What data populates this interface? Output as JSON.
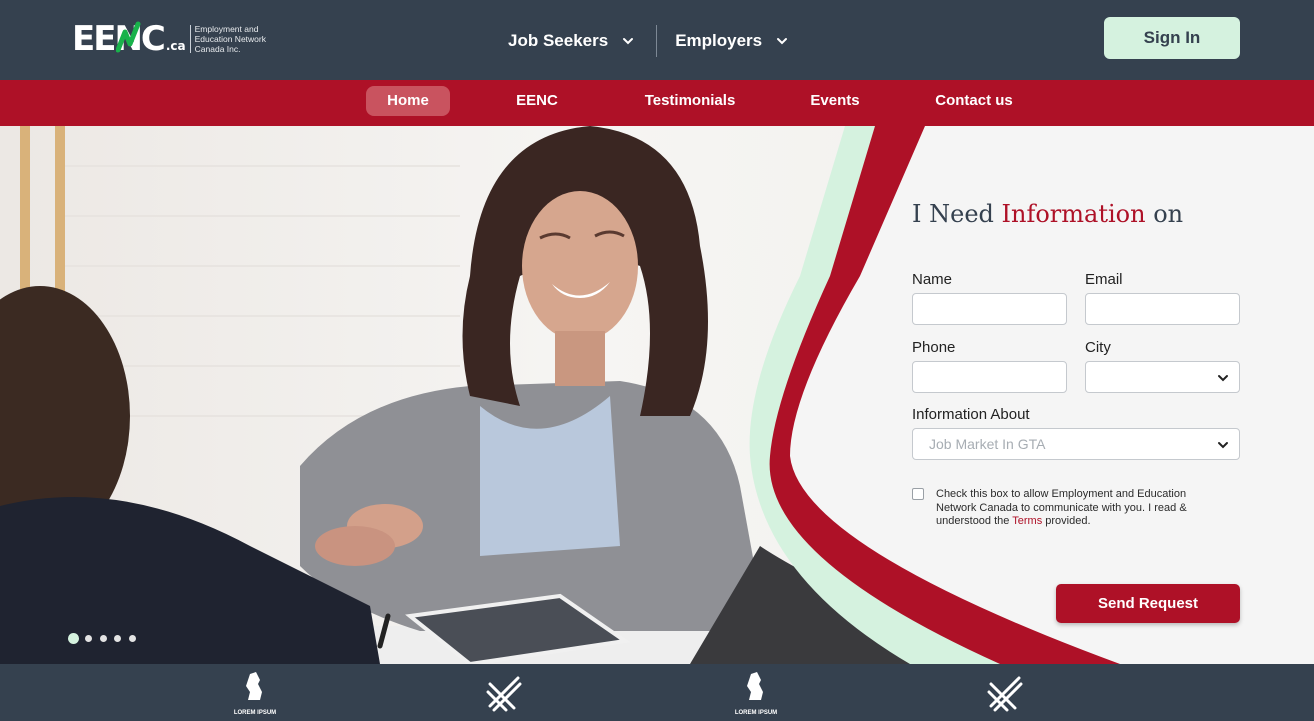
{
  "header": {
    "logo_text": "EENC",
    "logo_suffix": ".ca",
    "logo_tagline": "Employment and Education Network Canada Inc.",
    "nav": [
      {
        "label": "Job Seekers"
      },
      {
        "label": "Employers"
      }
    ],
    "signin_label": "Sign In"
  },
  "subnav": {
    "items": [
      {
        "label": "Home",
        "active": true
      },
      {
        "label": "EENC",
        "active": false
      },
      {
        "label": "Testimonials",
        "active": false
      },
      {
        "label": "Events",
        "active": false
      },
      {
        "label": "Contact us",
        "active": false
      }
    ]
  },
  "form": {
    "title_pre": "I Need ",
    "title_highlight": "Information",
    "title_post": " on",
    "name_label": "Name",
    "email_label": "Email",
    "phone_label": "Phone",
    "city_label": "City",
    "city_value": "",
    "info_label": "Information About",
    "info_value": "Job Market In GTA",
    "consent_pre": "Check this box to allow Employment and Education Network Canada to communicate with you. I read & understood the ",
    "consent_link": "Terms",
    "consent_post": " provided.",
    "submit_label": "Send Request"
  },
  "carousel": {
    "slides": 5,
    "active_index": 0
  },
  "footer": {
    "logo_caption": "LOREM IPSUM"
  },
  "colors": {
    "header_bg": "#35414f",
    "brand_red": "#ae1127",
    "mint": "#d5f2df",
    "logo_green": "#19b24b"
  }
}
